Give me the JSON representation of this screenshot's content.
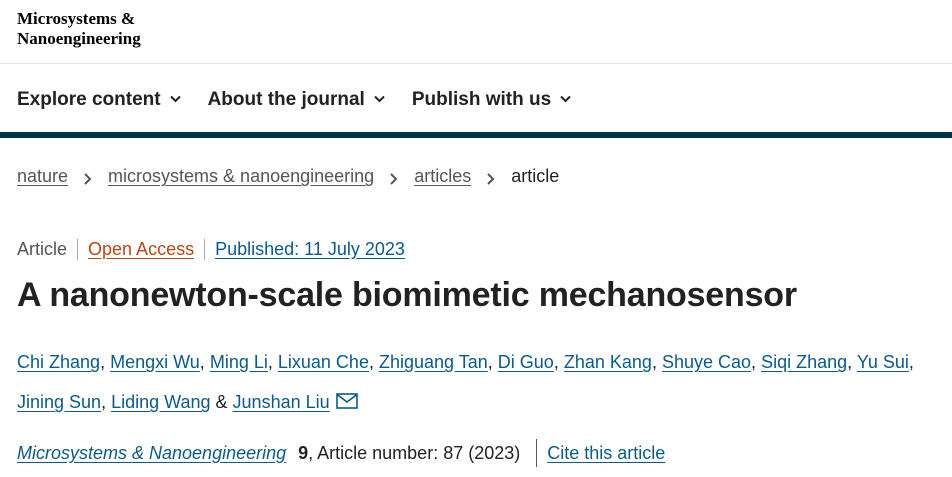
{
  "header": {
    "logo_line1": "Microsystems &",
    "logo_line2": "Nanoengineering"
  },
  "nav": {
    "items": [
      {
        "label": "Explore content"
      },
      {
        "label": "About the journal"
      },
      {
        "label": "Publish with us"
      }
    ]
  },
  "breadcrumb": {
    "items": [
      "nature",
      "microsystems & nanoengineering",
      "articles"
    ],
    "current": "article"
  },
  "article": {
    "type": "Article",
    "access": "Open Access",
    "published": "Published: 11 July 2023",
    "title": "A nanonewton-scale biomimetic mechanosensor",
    "authors": [
      "Chi Zhang",
      "Mengxi Wu",
      "Ming Li",
      "Lixuan Che",
      "Zhiguang Tan",
      "Di Guo",
      "Zhan Kang",
      "Shuye Cao",
      "Siqi Zhang",
      "Yu Sui",
      "Jining Sun",
      "Liding Wang",
      "Junshan Liu"
    ],
    "author_separator": ",",
    "author_last_joiner": "&",
    "journal": "Microsystems & Nanoengineering",
    "volume": "9",
    "article_number": ", Article number: 87 (2023)",
    "cite_label": "Cite this article"
  },
  "icons": {
    "nav_chevron": "chevron-down-icon",
    "breadcrumb_separator": "chevron-right-icon",
    "corresponding_author": "mail-icon"
  },
  "colors": {
    "brand_bar": "#01324b",
    "link": "#0c5a86",
    "open_access": "#b74616"
  }
}
